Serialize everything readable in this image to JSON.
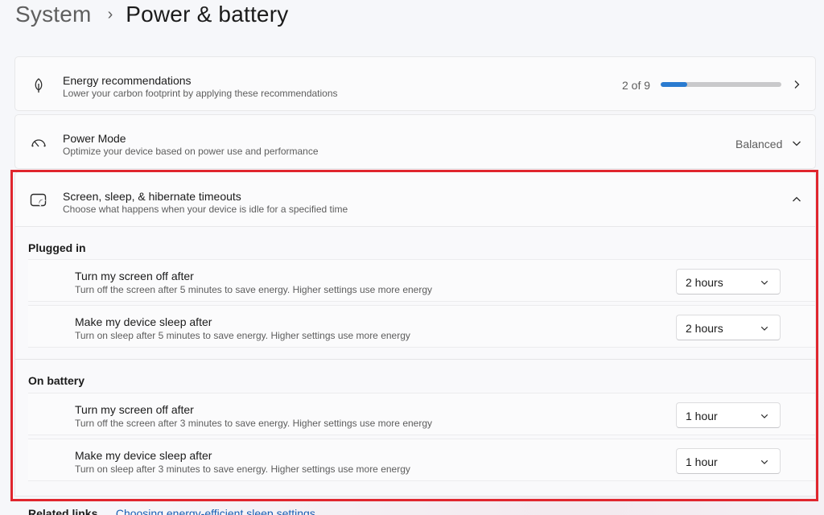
{
  "breadcrumb": {
    "parent": "System",
    "separator": "›",
    "current": "Power & battery"
  },
  "energy": {
    "title": "Energy recommendations",
    "subtitle": "Lower your carbon footprint by applying these recommendations",
    "progress_label": "2 of 9",
    "progress_fraction": 0.22,
    "icon": "leaf-icon"
  },
  "power_mode": {
    "title": "Power Mode",
    "subtitle": "Optimize your device based on power use and performance",
    "value": "Balanced",
    "icon": "speedometer-icon"
  },
  "timeouts": {
    "title": "Screen, sleep, & hibernate timeouts",
    "subtitle": "Choose what happens when your device is idle for a specified time",
    "icon": "screen-sleep-icon",
    "plugged_in": {
      "label": "Plugged in",
      "screen_off": {
        "title": "Turn my screen off after",
        "subtitle": "Turn off the screen after 5 minutes to save energy. Higher settings use more energy",
        "value": "2 hours"
      },
      "sleep": {
        "title": "Make my device sleep after",
        "subtitle": "Turn on sleep after 5 minutes to save energy. Higher settings use more energy",
        "value": "2 hours"
      }
    },
    "on_battery": {
      "label": "On battery",
      "screen_off": {
        "title": "Turn my screen off after",
        "subtitle": "Turn off the screen after 3 minutes to save energy. Higher settings use more energy",
        "value": "1 hour"
      },
      "sleep": {
        "title": "Make my device sleep after",
        "subtitle": "Turn on sleep after 3 minutes to save energy. Higher settings use more energy",
        "value": "1 hour"
      }
    }
  },
  "related": {
    "label": "Related links",
    "link": "Choosing energy-efficient sleep settings"
  },
  "colors": {
    "accent": "#2a7bd0",
    "highlight": "#e0262e",
    "link": "#1a5fb4"
  }
}
